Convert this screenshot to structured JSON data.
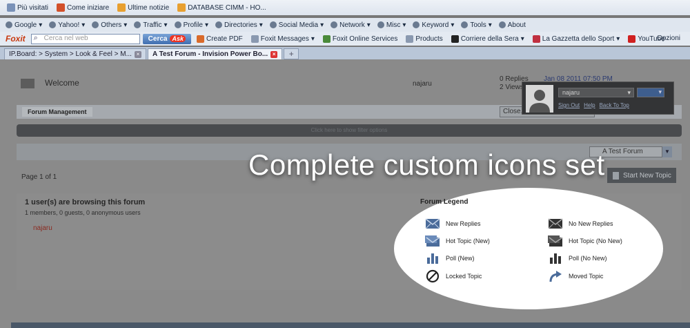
{
  "bookmarks": [
    "Più visitati",
    "Come iniziare",
    "Ultime notizie",
    "DATABASE CIMM - HO..."
  ],
  "toolbar1": [
    "Google",
    "Yahoo!",
    "Others",
    "Traffic",
    "Profile",
    "Directories",
    "Social Media",
    "Network",
    "Misc",
    "Keyword",
    "Tools",
    "About"
  ],
  "toolbar2": {
    "brand": "Foxit",
    "search_placeholder": "Cerca nel web",
    "search_button": "Cerca",
    "ask": "Ask",
    "items": [
      "Create PDF",
      "Foxit Messages",
      "Foxit Online Services",
      "Products",
      "Corriere della Sera",
      "La Gazzetta dello Sport",
      "YouTube"
    ],
    "options": "Opzioni"
  },
  "tabs": [
    {
      "label": "IP.Board: > System > Look & Feel > M..."
    },
    {
      "label": "A Test Forum - Invision Power Bo..."
    }
  ],
  "forum_row": {
    "title": "Welcome",
    "author": "najaru",
    "replies": "0 Replies",
    "views": "2 Views",
    "last_date": "Jan 08 2011 07:50 PM"
  },
  "management": {
    "label": "Forum Management",
    "close_select": "Close..."
  },
  "filter_bar": "Click here to show filter options",
  "jump_to": "A Test Forum",
  "pagination": "Page 1 of 1",
  "start_topic": "Start New Topic",
  "browsing": {
    "title": "1 user(s) are browsing this forum",
    "counts": "1 members, 0 guests, 0 anonymous users",
    "user": "najaru"
  },
  "headline": "Complete custom icons set",
  "legend": {
    "title": "Forum Legend",
    "items": [
      {
        "label": "New Replies",
        "icon": "envelope-new-icon"
      },
      {
        "label": "No New Replies",
        "icon": "envelope-icon"
      },
      {
        "label": "Hot Topic (New)",
        "icon": "hot-envelope-new-icon"
      },
      {
        "label": "Hot Topic (No New)",
        "icon": "hot-envelope-icon"
      },
      {
        "label": "Poll (New)",
        "icon": "poll-new-icon"
      },
      {
        "label": "Poll (No New)",
        "icon": "poll-icon"
      },
      {
        "label": "Locked Topic",
        "icon": "locked-icon"
      },
      {
        "label": "Moved Topic",
        "icon": "moved-arrow-icon"
      }
    ]
  },
  "user_panel": {
    "username": "najaru",
    "links": [
      "Sign Out",
      "Help",
      "Back To Top"
    ]
  },
  "colors": {
    "legend_blue": "#4a6b9a",
    "legend_dark": "#333333",
    "panel_bg": "#333436"
  }
}
